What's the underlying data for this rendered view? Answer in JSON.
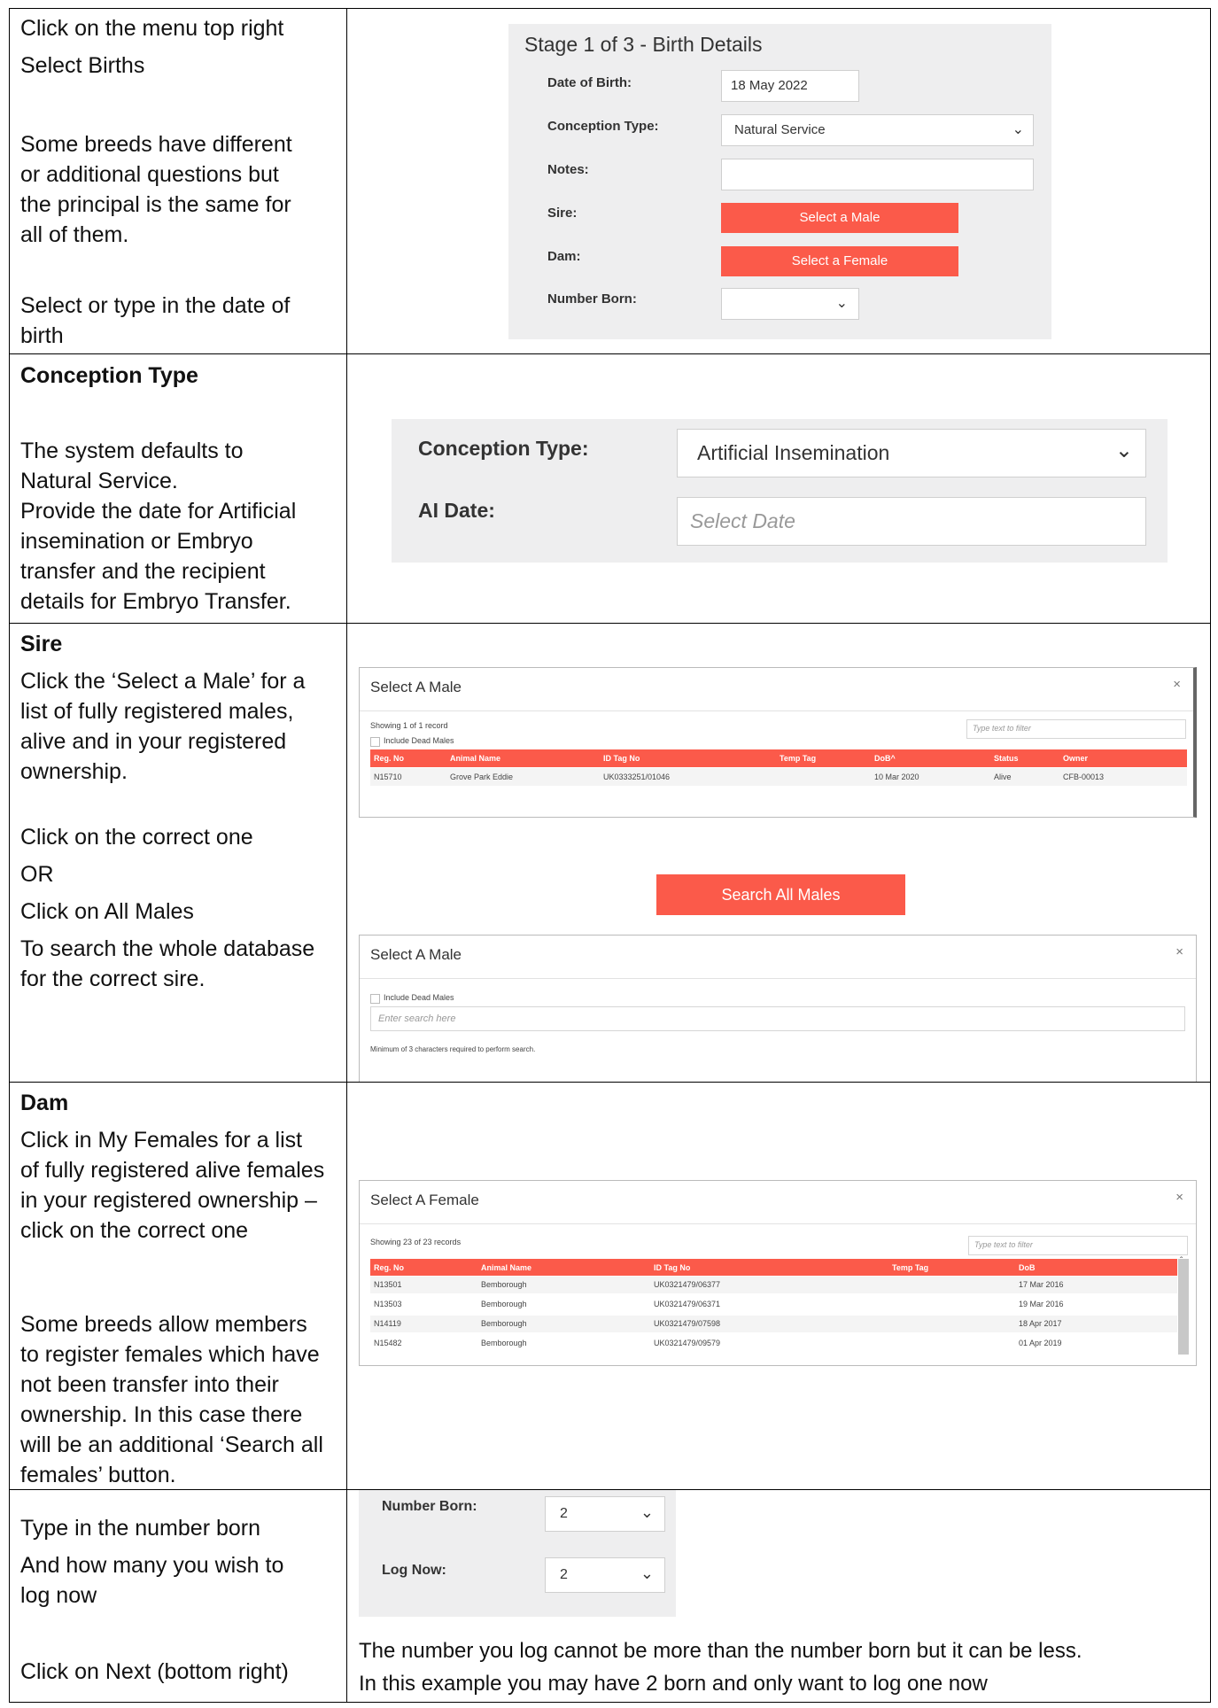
{
  "row1": {
    "left": [
      "Click on the menu top right",
      "Select Births",
      "Some breeds have different or additional questions but the principal is the same for all of them.",
      "Select or type in the date of birth"
    ],
    "form": {
      "title": "Stage 1 of 3 - Birth Details",
      "dob_label": "Date of Birth:",
      "dob_value": "18 May 2022",
      "conception_label": "Conception Type:",
      "conception_value": "Natural Service",
      "notes_label": "Notes:",
      "sire_label": "Sire:",
      "sire_button": "Select a Male",
      "dam_label": "Dam:",
      "dam_button": "Select a Female",
      "number_born_label": "Number Born:"
    }
  },
  "row2": {
    "heading": "Conception Type",
    "left": [
      "The system defaults to Natural Service.",
      "Provide the date for Artificial insemination or Embryo transfer and the recipient details for Embryo Transfer."
    ],
    "form": {
      "conception_label": "Conception Type:",
      "conception_value": "Artificial Insemination",
      "ai_label": "AI Date:",
      "ai_placeholder": "Select Date"
    }
  },
  "row3": {
    "heading": "Sire",
    "left": [
      "Click the ‘Select a Male’ for a list of fully registered males, alive and in your registered ownership.",
      "Click on the correct one",
      "OR",
      "Click on All Males",
      "To search the whole database for the correct sire."
    ],
    "dialog1": {
      "title": "Select A Male",
      "close": "×",
      "showing": "Showing 1 of 1 record",
      "filter_placeholder": "Type text to filter",
      "include_dead": "Include Dead Males",
      "columns": [
        "Reg. No",
        "Animal Name",
        "ID Tag No",
        "Temp Tag",
        "DoB^",
        "Status",
        "Owner"
      ],
      "rows": [
        [
          "N15710",
          "Grove Park Eddie",
          "UK0333251/01046",
          "",
          "10 Mar 2020",
          "Alive",
          "CFB-00013"
        ]
      ]
    },
    "search_all_button": "Search All Males",
    "dialog2": {
      "title": "Select A Male",
      "close": "×",
      "include_dead": "Include Dead Males",
      "search_placeholder": "Enter search here",
      "hint": "Minimum of 3 characters required to perform search."
    }
  },
  "row4": {
    "heading": "Dam",
    "left": [
      "Click in My Females for a list of fully registered alive females in your registered ownership – click on the correct one",
      "Some breeds allow members to register females which have not been transfer into their ownership.  In this case there will be an additional ‘Search all females’ button."
    ],
    "dialog": {
      "title": "Select A Female",
      "close": "×",
      "showing": "Showing 23 of 23 records",
      "filter_placeholder": "Type text to filter",
      "columns": [
        "Reg. No",
        "Animal Name",
        "ID Tag No",
        "Temp Tag",
        "DoB"
      ],
      "rows": [
        [
          "N13501",
          "Bemborough",
          "UK0321479/06377",
          "",
          "17 Mar 2016"
        ],
        [
          "N13503",
          "Bemborough",
          "UK0321479/06371",
          "",
          "19 Mar 2016"
        ],
        [
          "N14119",
          "Bemborough",
          "UK0321479/07598",
          "",
          "18 Apr 2017"
        ],
        [
          "N15482",
          "Bemborough",
          "UK0321479/09579",
          "",
          "01 Apr 2019"
        ]
      ]
    }
  },
  "row5": {
    "left": [
      "Type in the number born",
      "And how many you wish to log now",
      "Click on Next (bottom right)"
    ],
    "form": {
      "number_born_label": "Number Born:",
      "number_born_value": "2",
      "log_now_label": "Log Now:",
      "log_now_value": "2"
    },
    "note1": "The number you log cannot be more than the number born but it can be less.",
    "note2": "In this example you may have 2 born and only want to log one now"
  }
}
